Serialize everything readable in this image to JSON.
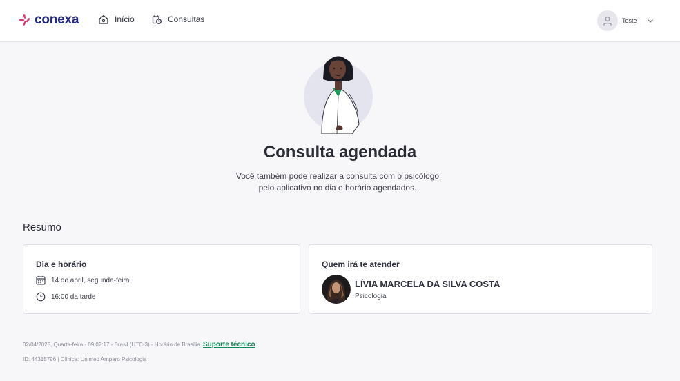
{
  "header": {
    "logo_text": "conexa",
    "nav": [
      {
        "label": "Início",
        "icon": "home-icon"
      },
      {
        "label": "Consultas",
        "icon": "calendar-clock-icon"
      }
    ],
    "user": {
      "name": "Teste",
      "icon": "user-icon"
    }
  },
  "hero": {
    "title": "Consulta agendada",
    "subtitle": "Você também pode realizar a consulta com o psicólogo pelo aplicativo no dia e horário agendados."
  },
  "resumo": {
    "title": "Resumo",
    "schedule": {
      "heading": "Dia e horário",
      "date": "14 de abril, segunda-feira",
      "time": "16:00 da tarde"
    },
    "professional": {
      "heading": "Quem irá te atender",
      "name": "LÍVIA MARCELA DA SILVA COSTA",
      "role": "Psicologia"
    }
  },
  "footer": {
    "datetime": "02/04/2025, Quarta-feira - 09:02:17 - Brasil (UTC-3) - Horário de Brasília",
    "support_link": "Suporte técnico",
    "id_line": "ID: 44315796 | Clínica: Unimed Amparo Psicologia"
  },
  "colors": {
    "brand": "#1f2a8a",
    "accent_pink": "#e8336e",
    "link_green": "#148a5c",
    "background": "#f7f7fa"
  }
}
